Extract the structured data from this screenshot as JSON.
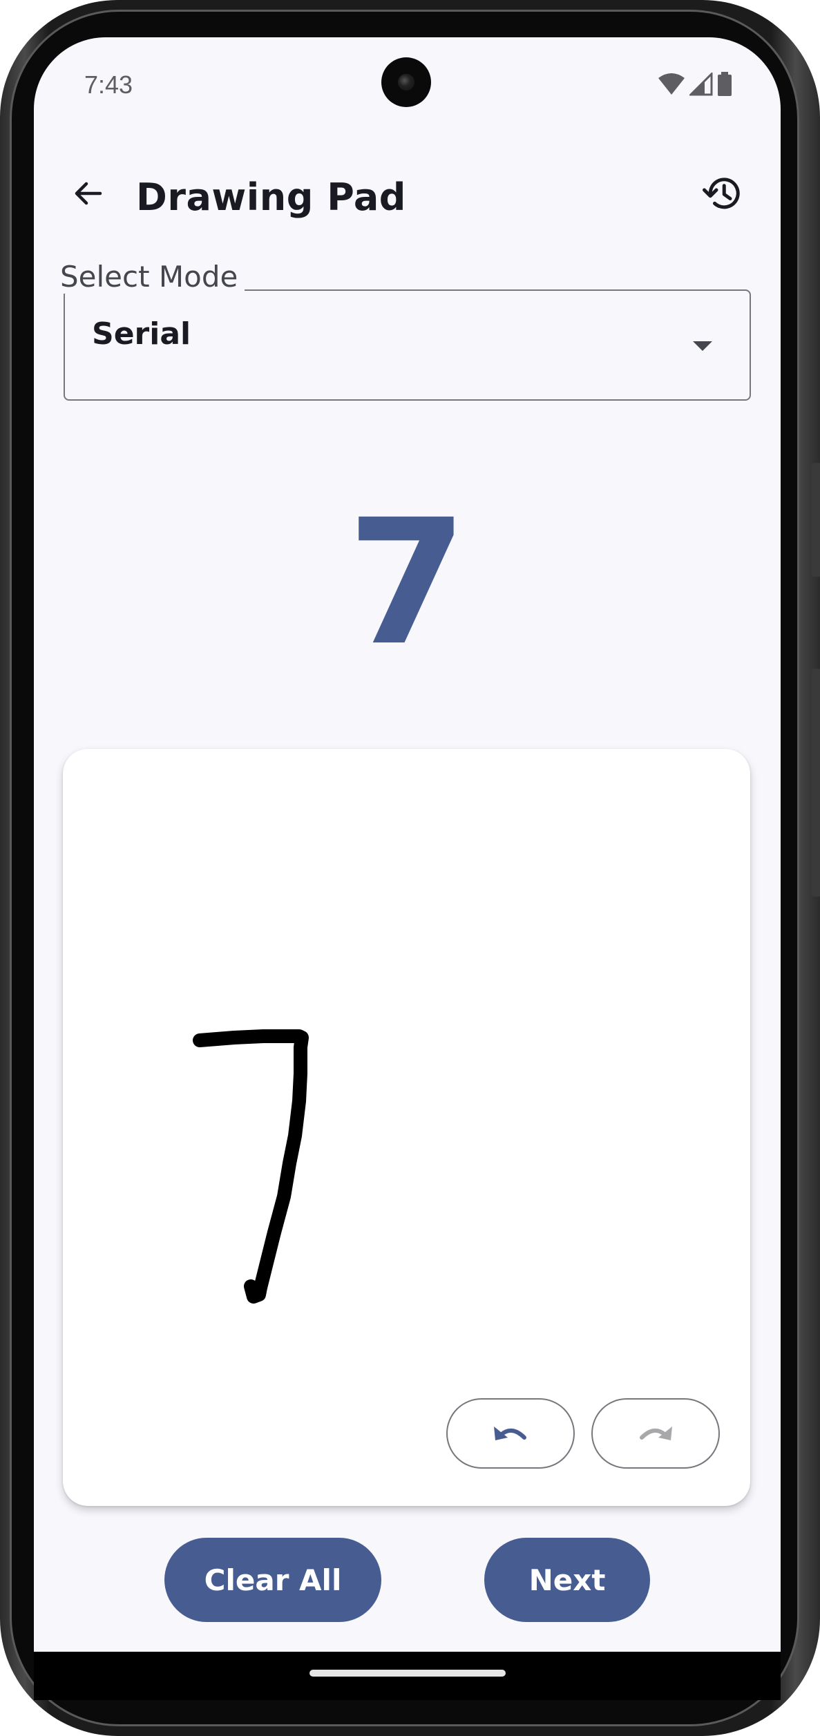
{
  "status_bar": {
    "time": "7:43",
    "icons": [
      "wifi-icon",
      "cell-signal-icon",
      "battery-icon"
    ]
  },
  "app_bar": {
    "back_icon": "arrow-back-icon",
    "title": "Drawing Pad",
    "history_icon": "history-icon"
  },
  "mode_select": {
    "label": "Select Mode",
    "value": "Serial",
    "icon": "dropdown-arrow-icon"
  },
  "target": {
    "digit": "7"
  },
  "canvas": {
    "undo_icon": "undo-icon",
    "redo_icon": "redo-icon",
    "redo_enabled": false
  },
  "actions": {
    "clear_label": "Clear All",
    "next_label": "Next"
  },
  "colors": {
    "primary": "#475d92",
    "background": "#f7f7fc",
    "outline": "#76777d",
    "on_surface": "#1a1b22",
    "disabled_icon": "#a8a8ab"
  }
}
